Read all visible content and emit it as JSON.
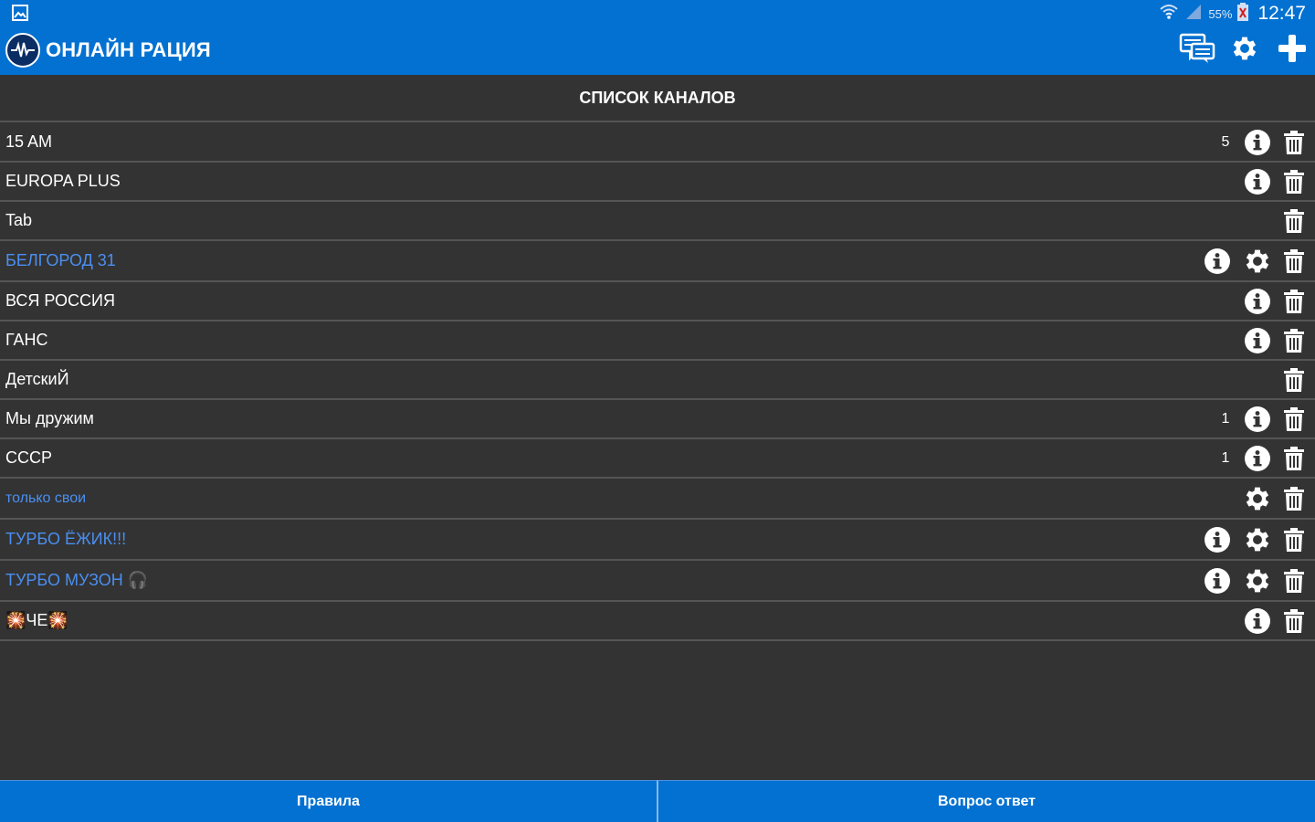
{
  "colors": {
    "header_bg": "#0271d1",
    "list_bg": "#333333",
    "divider": "#555555",
    "owned_channel_text": "#4a8ff0",
    "text": "#ffffff"
  },
  "status_bar": {
    "left_icon": "gallery-icon",
    "wifi_icon": "wifi-icon",
    "signal_icon": "signal-icon",
    "battery_percent": "55%",
    "battery_icon": "battery-icon",
    "time": "12:47"
  },
  "header": {
    "logo_icon": "waveform-logo-icon",
    "title": "ОНЛАЙН РАЦИЯ",
    "actions": [
      {
        "name": "messages-button",
        "icon": "chat-icon"
      },
      {
        "name": "settings-button",
        "icon": "gear-icon"
      },
      {
        "name": "add-button",
        "icon": "plus-icon"
      }
    ]
  },
  "section_title": "СПИСОК КАНАЛОВ",
  "channels": [
    {
      "name": "15 AM",
      "count": "5",
      "owned": false,
      "info": true,
      "settings": false,
      "delete": true
    },
    {
      "name": "EUROPA PLUS",
      "count": "",
      "owned": false,
      "info": true,
      "settings": false,
      "delete": true
    },
    {
      "name": "Tab",
      "count": "",
      "owned": false,
      "info": false,
      "settings": false,
      "delete": true
    },
    {
      "name": "БЕЛГОРОД 31",
      "count": "",
      "owned": true,
      "info": true,
      "settings": true,
      "delete": true
    },
    {
      "name": "ВСЯ РОССИЯ",
      "count": "",
      "owned": false,
      "info": true,
      "settings": false,
      "delete": true
    },
    {
      "name": "ГАНС",
      "count": "",
      "owned": false,
      "info": true,
      "settings": false,
      "delete": true
    },
    {
      "name": "ДетскиЙ",
      "count": "",
      "owned": false,
      "info": false,
      "settings": false,
      "delete": true
    },
    {
      "name": "Мы дружим",
      "count": "1",
      "owned": false,
      "info": true,
      "settings": false,
      "delete": true
    },
    {
      "name": "СССР",
      "count": "1",
      "owned": false,
      "info": true,
      "settings": false,
      "delete": true
    },
    {
      "name": "только свои",
      "count": "",
      "owned": true,
      "info": false,
      "settings": true,
      "delete": true
    },
    {
      "name": "ТУРБО ЁЖИК!!!",
      "count": "",
      "owned": true,
      "info": true,
      "settings": true,
      "delete": true
    },
    {
      "name": "ТУРБО МУЗОН 🎧",
      "count": "",
      "owned": true,
      "info": true,
      "settings": true,
      "delete": true
    },
    {
      "name": "🎇ЧЕ🎇",
      "count": "",
      "owned": false,
      "info": true,
      "settings": false,
      "delete": true
    }
  ],
  "bottom_bar": {
    "rules_label": "Правила",
    "faq_label": "Вопрос ответ"
  }
}
